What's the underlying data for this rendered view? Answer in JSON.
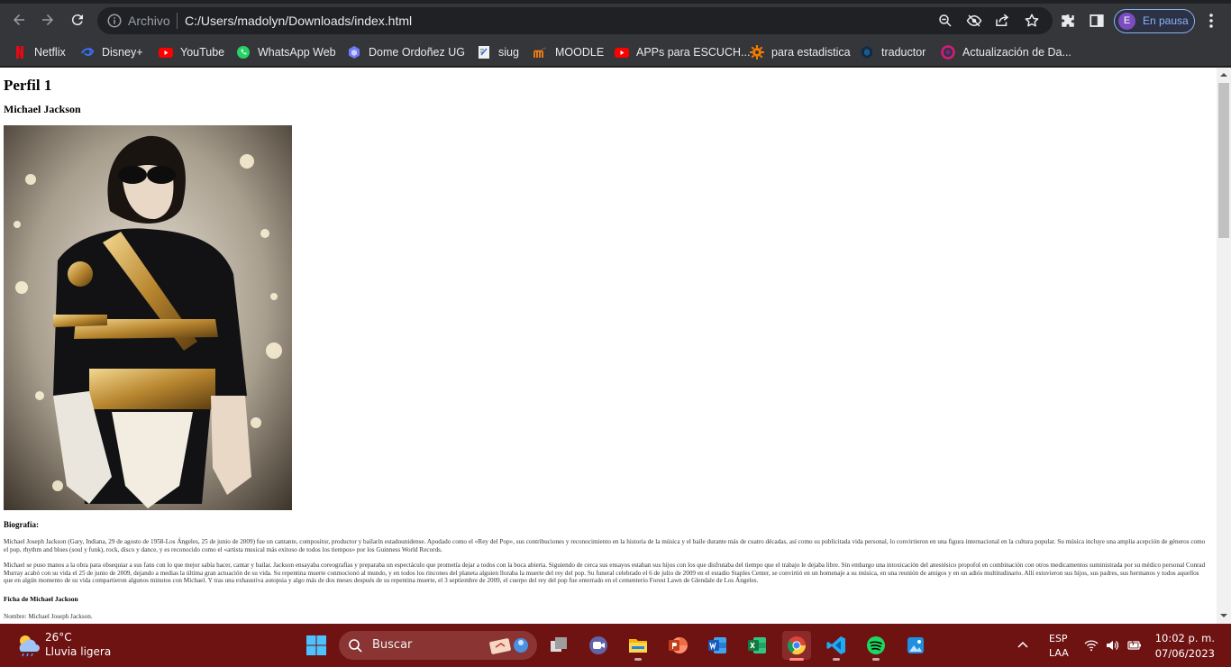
{
  "browser": {
    "scheme_label": "Archivo",
    "url": "C:/Users/madolyn/Downloads/index.html",
    "profile_initial": "E",
    "profile_label": "En pausa",
    "icons": [
      "back-icon",
      "forward-icon",
      "reload-icon",
      "info-icon",
      "zoom-icon",
      "eye-off-icon",
      "share-icon",
      "star-icon",
      "puzzle-icon",
      "sidepanel-icon",
      "more-vert-icon"
    ]
  },
  "bookmarks": [
    {
      "label": "Netflix",
      "icon": "netflix-icon"
    },
    {
      "label": "Disney+",
      "icon": "disney-icon"
    },
    {
      "label": "YouTube",
      "icon": "youtube-icon"
    },
    {
      "label": "WhatsApp Web",
      "icon": "whatsapp-icon"
    },
    {
      "label": "Dome Ordoñez UG",
      "icon": "hexagon-icon"
    },
    {
      "label": "siug",
      "icon": "document-icon"
    },
    {
      "label": "MOODLE",
      "icon": "moodle-icon"
    },
    {
      "label": "APPs para ESCUCH...",
      "icon": "youtube-icon"
    },
    {
      "label": "para estadistica",
      "icon": "gear-icon"
    },
    {
      "label": "traductor",
      "icon": "shield-icon"
    },
    {
      "label": "Actualización de Da...",
      "icon": "circle-icon"
    }
  ],
  "page": {
    "heading": "Perfil 1",
    "subheading": "Michael Jackson",
    "bio_title": "Biografía:",
    "bio_p1": "Michael Joseph Jackson (Gary, Indiana, 29 de agosto de 1958-Los Ángeles, 25 de junio de 2009) fue un cantante, compositor, productor y bailarín estadounidense. Apodado como el «Rey del Pop», sus contribuciones y reconocimiento en la historia de la música y el baile durante más de cuatro décadas, así como su publicitada vida personal, lo convirtieron en una figura internacional en la cultura popular. Su música incluye una amplia acepción de géneros como el pop, rhythm and blues (soul y funk), rock, disco y dance, y es reconocido como el «artista musical más exitoso de todos los tiempos» por los Guinness World Records.",
    "bio_p2": "Michael se puso manos a la obra para obsequiar a sus fans con lo que mejor sabía hacer, cantar y bailar. Jackson ensayaba coreografías y preparaba un espectáculo que prometía dejar a todos con la boca abierta. Siguiendo de cerca sus ensayos estaban sus hijos con los que disfrutaba del tiempo que el trabajo le dejaba libre. Sin embargo una intoxicación del anestésico propofol en combinación con otros medicamentos suministrada por su médico personal Conrad Murray acabó con su vida el 25 de junio de 2009, dejando a medias la última gran actuación de su vida. Su repentina muerte conmocionó al mundo, y en todos los rincones del planeta alguien lloraba la muerte del rey del pop. Su funeral celebrado el 6 de julio de 2009 en el estadio Staples Center, se convirtió en un homenaje a su música, en una reunión de amigos y en un adiós multitudinario. Allí estuvieron sus hijos, sus padres, sus hermanos y todos aquellos que en algún momento de su vida compartieron algunos minutos con Michael. Y tras una exhaustiva autopsia y algo más de dos meses después de su repentina muerte, el 3 septiembre de 2009, el cuerpo del rey del pop fue enterrado en el cementerio Forest Lawn de Glendale de Los Ángeles.",
    "ficha_title": "Ficha de Michael Jackson",
    "nombre": "Nombre: Michael Joseph Jackson."
  },
  "taskbar": {
    "weather_temp": "26°C",
    "weather_desc": "Lluvia ligera",
    "search_label": "Buscar",
    "apps": [
      "task-view-icon",
      "teams-icon",
      "file-explorer-icon",
      "powerpoint-icon",
      "word-icon",
      "excel-icon",
      "chrome-icon",
      "vscode-icon",
      "spotify-icon",
      "photos-icon"
    ],
    "lang_1": "ESP",
    "lang_2": "LAA",
    "time": "10:02 p. m.",
    "date": "07/06/2023"
  },
  "colors": {
    "chrome_dark": "#35363a",
    "taskbar": "#6e1212",
    "accent_blue": "#8ab4f8"
  }
}
